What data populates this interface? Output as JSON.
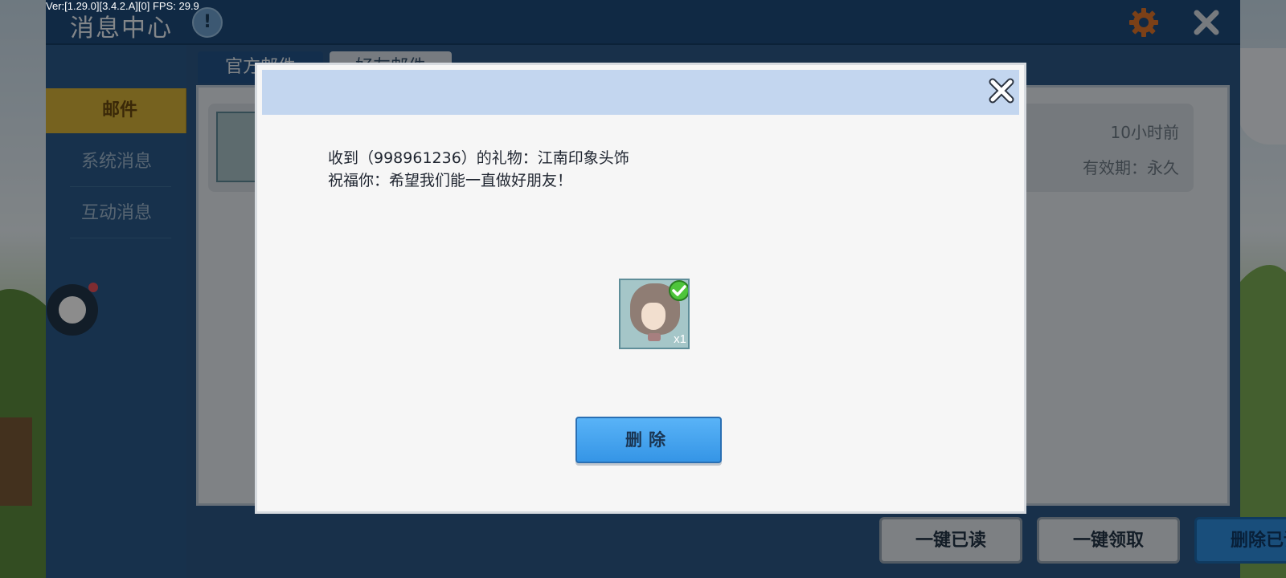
{
  "debug": {
    "text": "Ver:[1.29.0][3.4.2.A][0] FPS: 29.9"
  },
  "header": {
    "title": "消息中心",
    "info_icon": "!"
  },
  "sidebar": {
    "items": [
      {
        "label": "邮件",
        "active": true
      },
      {
        "label": "系统消息",
        "active": false
      },
      {
        "label": "互动消息",
        "active": false
      }
    ]
  },
  "tabs": [
    {
      "label": "官方邮件"
    },
    {
      "label": "好友邮件"
    }
  ],
  "mail_card": {
    "time": "10小时前",
    "validity": "有效期：永久"
  },
  "bottom_buttons": {
    "read_all": "一键已读",
    "claim_all": "一键领取",
    "delete_read": "删除已读"
  },
  "dialog": {
    "line1": "收到（998961236）的礼物：江南印象头饰",
    "line2": "祝福你：希望我们能一直做好朋友！",
    "item_count": "x1",
    "delete_label": "删除"
  },
  "colors": {
    "panel": "#2b5888",
    "titlebar": "#1e4c7c",
    "active_tab": "#d8b33a",
    "dialog_header": "#c3d6ef",
    "primary_button": "#3595e6",
    "check_green": "#4ec53b"
  },
  "icons": {
    "settings": "gear-icon",
    "close_main": "close-icon",
    "close_dialog": "close-icon",
    "info": "info-icon",
    "check": "check-icon"
  }
}
